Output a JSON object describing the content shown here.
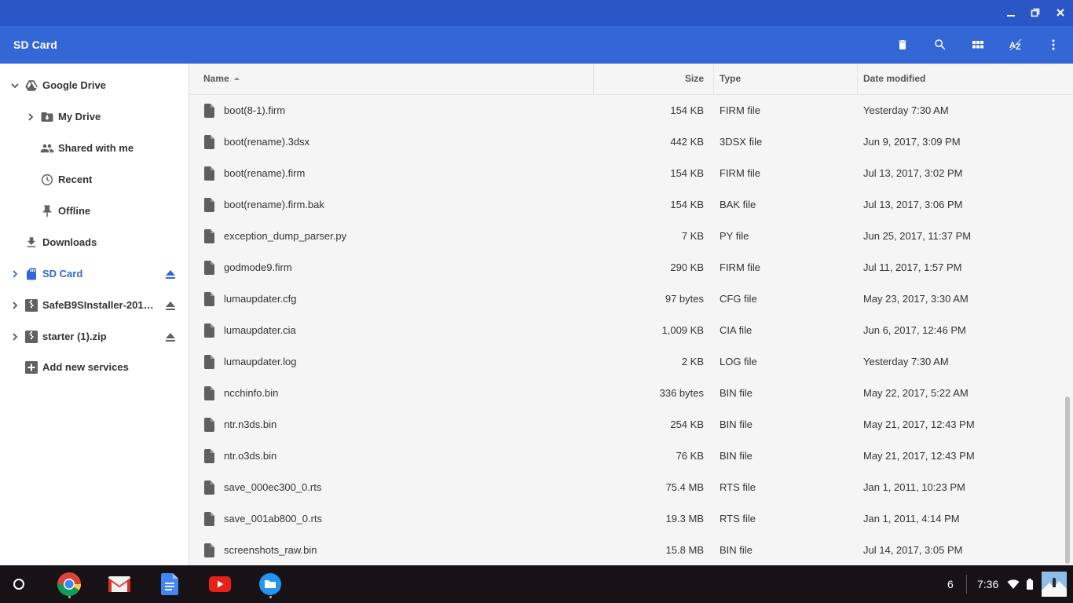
{
  "window": {
    "controls": [
      "minimize-icon",
      "restore-icon",
      "close-icon"
    ]
  },
  "appbar": {
    "title": "SD Card",
    "actions": [
      "delete-icon",
      "search-icon",
      "grid-view-icon",
      "sort-az-icon",
      "more-vert-icon"
    ],
    "accent_color": "#3367d6",
    "titlebar_color": "#2a56c6"
  },
  "sidebar": {
    "items": [
      {
        "label": "Google Drive",
        "icon": "google-drive-icon",
        "expander": "chevron-down-icon"
      },
      {
        "label": "My Drive",
        "icon": "my-drive-icon",
        "expander": "chevron-right-icon"
      },
      {
        "label": "Shared with me",
        "icon": "people-icon"
      },
      {
        "label": "Recent",
        "icon": "clock-icon"
      },
      {
        "label": "Offline",
        "icon": "pin-icon"
      },
      {
        "label": "Downloads",
        "icon": "download-icon"
      },
      {
        "label": "SD Card",
        "icon": "sd-card-icon",
        "expander": "chevron-right-icon",
        "eject": "eject-icon",
        "selected": true
      },
      {
        "label": "SafeB9SInstaller-201…",
        "icon": "archive-icon",
        "expander": "chevron-right-icon",
        "eject": "eject-icon"
      },
      {
        "label": "starter (1).zip",
        "icon": "archive-icon",
        "expander": "chevron-right-icon",
        "eject": "eject-icon"
      },
      {
        "label": "Add new services",
        "icon": "add-box-icon"
      }
    ],
    "selected_color": "#3367d6"
  },
  "table": {
    "headers": {
      "name": "Name",
      "size": "Size",
      "type": "Type",
      "date": "Date modified"
    },
    "sort_indicator": "sort-up-icon",
    "rows": [
      {
        "name": "boot(8-1).firm",
        "size": "154 KB",
        "type": "FIRM file",
        "date": "Yesterday 7:30 AM"
      },
      {
        "name": "boot(rename).3dsx",
        "size": "442 KB",
        "type": "3DSX file",
        "date": "Jun 9, 2017, 3:09 PM"
      },
      {
        "name": "boot(rename).firm",
        "size": "154 KB",
        "type": "FIRM file",
        "date": "Jul 13, 2017, 3:02 PM"
      },
      {
        "name": "boot(rename).firm.bak",
        "size": "154 KB",
        "type": "BAK file",
        "date": "Jul 13, 2017, 3:06 PM"
      },
      {
        "name": "exception_dump_parser.py",
        "size": "7 KB",
        "type": "PY file",
        "date": "Jun 25, 2017, 11:37 PM"
      },
      {
        "name": "godmode9.firm",
        "size": "290 KB",
        "type": "FIRM file",
        "date": "Jul 11, 2017, 1:57 PM"
      },
      {
        "name": "lumaupdater.cfg",
        "size": "97 bytes",
        "type": "CFG file",
        "date": "May 23, 2017, 3:30 AM"
      },
      {
        "name": "lumaupdater.cia",
        "size": "1,009 KB",
        "type": "CIA file",
        "date": "Jun 6, 2017, 12:46 PM"
      },
      {
        "name": "lumaupdater.log",
        "size": "2 KB",
        "type": "LOG file",
        "date": "Yesterday 7:30 AM"
      },
      {
        "name": "ncchinfo.bin",
        "size": "336 bytes",
        "type": "BIN file",
        "date": "May 22, 2017, 5:22 AM"
      },
      {
        "name": "ntr.n3ds.bin",
        "size": "254 KB",
        "type": "BIN file",
        "date": "May 21, 2017, 12:43 PM"
      },
      {
        "name": "ntr.o3ds.bin",
        "size": "76 KB",
        "type": "BIN file",
        "date": "May 21, 2017, 12:43 PM"
      },
      {
        "name": "save_000ec300_0.rts",
        "size": "75.4 MB",
        "type": "RTS file",
        "date": "Jan 1, 2011, 10:23 PM"
      },
      {
        "name": "save_001ab800_0.rts",
        "size": "19.3 MB",
        "type": "RTS file",
        "date": "Jan 1, 2011, 4:14 PM"
      },
      {
        "name": "screenshots_raw.bin",
        "size": "15.8 MB",
        "type": "BIN file",
        "date": "Jul 14, 2017, 3:05 PM"
      }
    ]
  },
  "shelf": {
    "apps": [
      "launcher-icon",
      "chrome-icon",
      "gmail-icon",
      "docs-icon",
      "youtube-icon",
      "files-icon"
    ],
    "notification_count": "6",
    "time": "7:36",
    "status_icons": [
      "wifi-icon",
      "battery-icon",
      "avatar"
    ]
  }
}
